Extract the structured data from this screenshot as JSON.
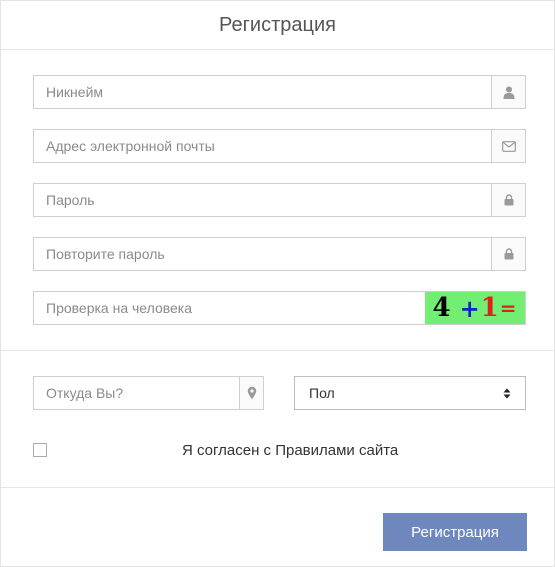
{
  "header": {
    "title": "Регистрация"
  },
  "fields": {
    "nickname": {
      "placeholder": "Никнейм",
      "icon": "user-icon"
    },
    "email": {
      "placeholder": "Адрес электронной почты",
      "icon": "envelope-icon"
    },
    "password": {
      "placeholder": "Пароль",
      "icon": "lock-icon"
    },
    "password_repeat": {
      "placeholder": "Повторите пароль",
      "icon": "lock-icon"
    },
    "captcha": {
      "placeholder": "Проверка на человека",
      "n1": "4",
      "op1": "+",
      "n2": "1",
      "op2": "="
    },
    "location": {
      "placeholder": "Откуда Вы?",
      "icon": "map-marker-icon"
    },
    "gender": {
      "selected": "Пол"
    }
  },
  "agreement": {
    "label": "Я согласен с Правилами сайта",
    "checked": false
  },
  "submit": {
    "label": "Регистрация"
  },
  "colors": {
    "accent": "#6e87bd",
    "captcha_bg": "#72ee72"
  }
}
